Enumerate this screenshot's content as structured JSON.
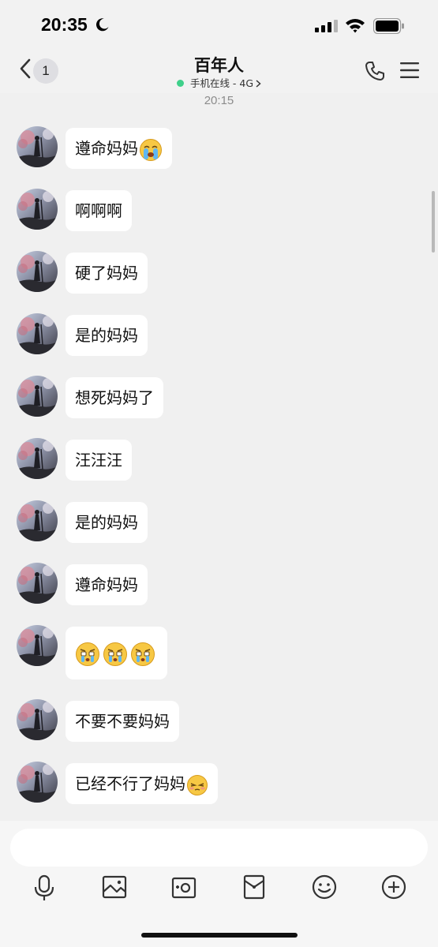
{
  "status_bar": {
    "time": "20:35",
    "icons": [
      "moon-icon",
      "signal-icon",
      "wifi-icon",
      "battery-icon"
    ]
  },
  "nav": {
    "back_badge": "1",
    "title": "百年人",
    "subtitle": "手机在线 - 4G",
    "online_color": "#3fd08a",
    "icons": [
      "back-chevron-icon",
      "phone-icon",
      "menu-icon"
    ]
  },
  "chat": {
    "timestamp": "20:15",
    "messages": [
      {
        "text": "遵命妈妈",
        "emoji": [
          "crying-emoji"
        ]
      },
      {
        "text": "啊啊啊",
        "emoji": []
      },
      {
        "text": "硬了妈妈",
        "emoji": []
      },
      {
        "text": "是的妈妈",
        "emoji": []
      },
      {
        "text": "想死妈妈了",
        "emoji": []
      },
      {
        "text": "汪汪汪",
        "emoji": []
      },
      {
        "text": "是的妈妈",
        "emoji": []
      },
      {
        "text": "遵命妈妈",
        "emoji": []
      },
      {
        "text": "",
        "emoji": [
          "teary-emoji",
          "teary-emoji",
          "teary-emoji"
        ]
      },
      {
        "text": "不要不要妈妈",
        "emoji": []
      },
      {
        "text": "已经不行了妈妈",
        "emoji": [
          "embarrassed-emoji"
        ]
      }
    ]
  },
  "composer": {
    "input_value": "",
    "toolbar": [
      "microphone-icon",
      "image-icon",
      "camera-icon",
      "red-packet-icon",
      "smiley-icon",
      "plus-icon"
    ]
  },
  "colors": {
    "background": "#f0f0f0",
    "bubble": "#ffffff",
    "accent_green": "#3fd08a"
  }
}
